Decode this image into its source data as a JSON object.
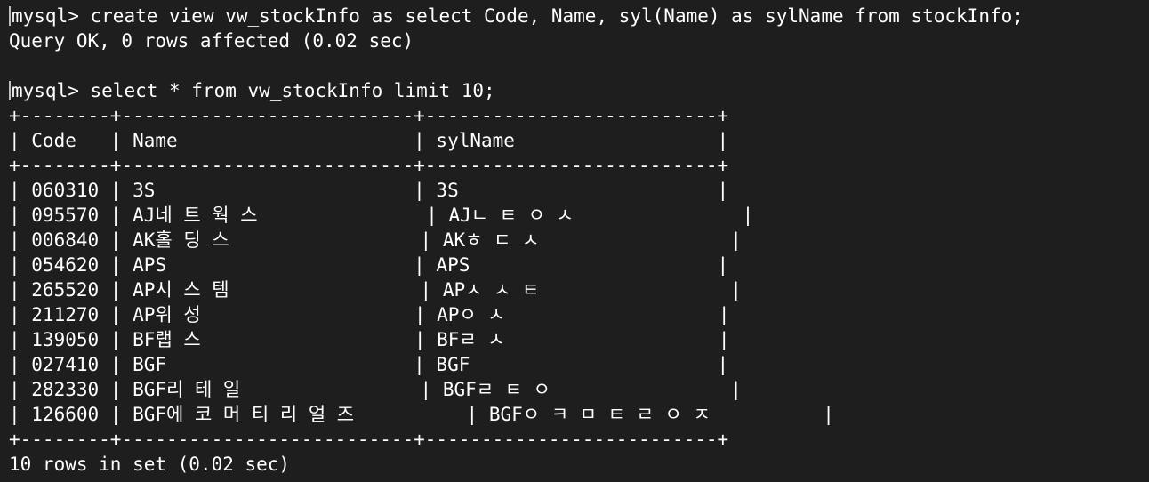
{
  "terminal": {
    "prompt": "mysql> ",
    "command1": "create view vw_stockInfo as select Code, Name, syl(Name) as sylName from stockInfo;",
    "result1": "Query OK, 0 rows affected (0.02 sec)",
    "command2": "select * from vw_stockInfo limit 10;",
    "footer": "10 rows in set (0.02 sec)"
  },
  "table": {
    "border_top": "+--------+--------------------------+--------------------------+",
    "border_mid": "+--------+--------------------------+--------------------------+",
    "border_bottom": "+--------+--------------------------+--------------------------+",
    "header": "| Code   | Name                     | sylName                  |",
    "rows": [
      "| 060310 | 3S                       | 3S                       |",
      "| 095570 | AJ네 트 웍 스               | AJㄴ ㅌ ㅇ ㅅ               |",
      "| 006840 | AK홀 딩 스                 | AKㅎ ㄷ ㅅ                 |",
      "| 054620 | APS                      | APS                      |",
      "| 265520 | AP시 스 템                 | APㅅ ㅅ ㅌ                 |",
      "| 211270 | AP위 성                   | APㅇ ㅅ                   |",
      "| 139050 | BF랩 스                   | BFㄹ ㅅ                   |",
      "| 027410 | BGF                      | BGF                      |",
      "| 282330 | BGF리 테 일                | BGFㄹ ㅌ ㅇ                |",
      "| 126600 | BGF에 코 머 티 리 얼 즈          | BGFㅇ ㅋ ㅁ ㅌ ㄹ ㅇ ㅈ          |"
    ]
  }
}
